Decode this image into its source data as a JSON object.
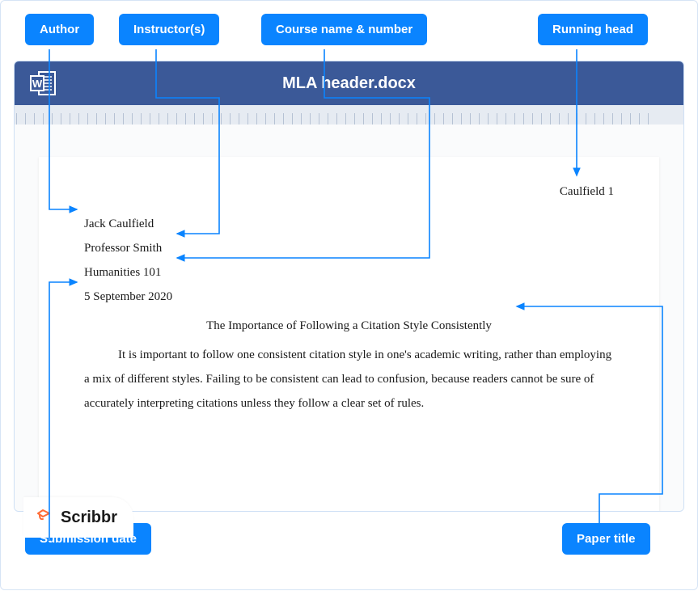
{
  "labels": {
    "author": "Author",
    "instructor": "Instructor(s)",
    "course": "Course name & number",
    "running_head": "Running head",
    "submission_date": "Submission date",
    "paper_title": "Paper title"
  },
  "document": {
    "filename": "MLA header.docx",
    "running_head": "Caulfield 1",
    "author_line": "Jack Caulfield",
    "instructor_line": "Professor Smith",
    "course_line": "Humanities 101",
    "date_line": "5 September 2020",
    "title": "The Importance of Following a Citation Style Consistently",
    "body": "It is important to follow one consistent citation style in one's academic writing, rather than employing a mix of different styles. Failing to be consistent can lead to confusion, because readers cannot be sure of accurately interpreting citations unless they follow a clear set of rules."
  },
  "branding": {
    "name": "Scribbr"
  },
  "colors": {
    "label_bg": "#0a84ff",
    "titlebar": "#3b5998",
    "arrow": "#0a84ff",
    "scribbr_orange": "#ff6b35"
  }
}
